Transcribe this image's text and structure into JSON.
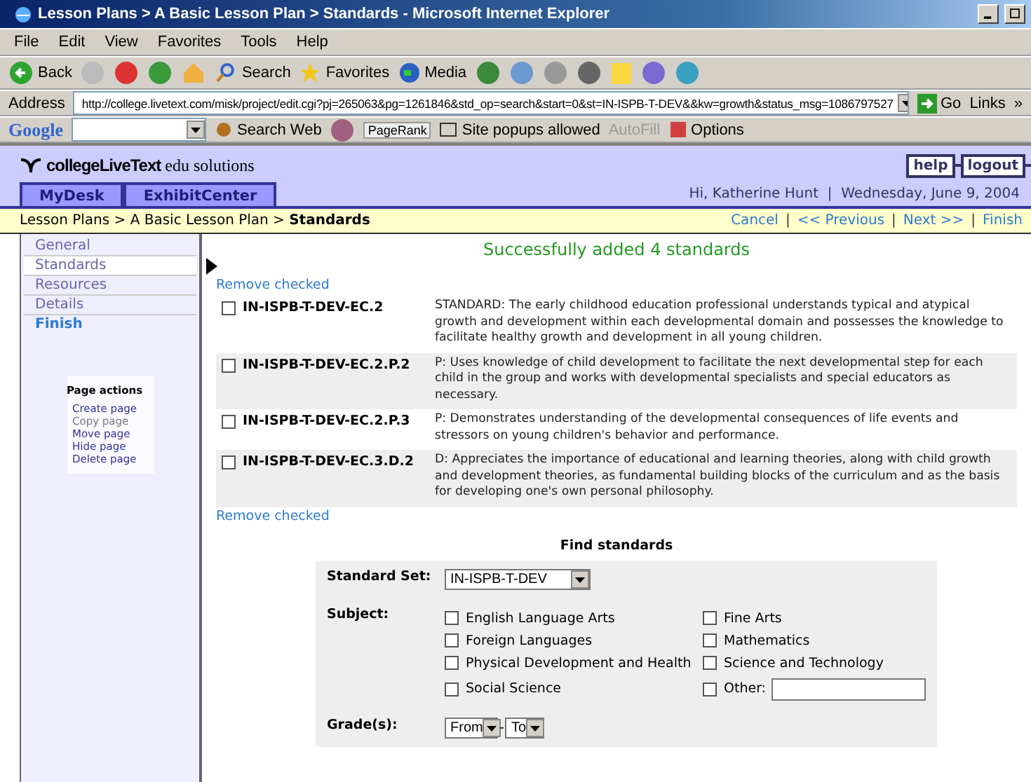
{
  "window": {
    "title": "Lesson Plans > A Basic Lesson Plan > Standards - Microsoft Internet Explorer"
  },
  "menu": [
    "File",
    "Edit",
    "View",
    "Favorites",
    "Tools",
    "Help"
  ],
  "toolbar": {
    "back": "Back",
    "search": "Search",
    "favorites": "Favorites",
    "media": "Media"
  },
  "address": {
    "label": "Address",
    "url": "http://college.livetext.com/misk/project/edit.cgi?pj=265063&pg=1261846&std_op=search&start=0&st=IN-ISPB-T-DEV&&kw=growth&status_msg=1086797527",
    "go": "Go",
    "links": "Links",
    "more": "»"
  },
  "google_bar": {
    "logo": "Google",
    "search_web": "Search Web",
    "pagerank": "PageRank",
    "popups": "Site popups allowed",
    "autofill": "AutoFill",
    "options": "Options"
  },
  "site": {
    "logo": "collegeLiveText",
    "logo_suffix": "edu solutions",
    "help": "help",
    "logout": "logout",
    "tabs": [
      {
        "label": "MyDesk"
      },
      {
        "label": "ExhibitCenter"
      }
    ],
    "greeting": "Hi, Katherine Hunt",
    "greeting_separator": "|",
    "date": "Wednesday, June 9, 2004"
  },
  "breadcrumb": {
    "parts": [
      "Lesson Plans",
      "A Basic Lesson Plan"
    ],
    "current": "Standards",
    "separator": ">"
  },
  "wizard_nav": [
    "Cancel",
    "<< Previous",
    "Next >>",
    "Finish"
  ],
  "wizard_nav_separator": "|",
  "sidebar": {
    "steps": [
      {
        "label": "General",
        "selected": false,
        "kind": "step"
      },
      {
        "label": "Standards",
        "selected": true,
        "kind": "step"
      },
      {
        "label": "Resources",
        "selected": false,
        "kind": "step"
      },
      {
        "label": "Details",
        "selected": false,
        "kind": "step"
      },
      {
        "label": "Finish",
        "selected": false,
        "kind": "finish"
      }
    ],
    "page_actions": {
      "title": "Page actions",
      "items": [
        {
          "label": "Create page",
          "disabled": false
        },
        {
          "label": "Copy page",
          "disabled": true
        },
        {
          "label": "Move page",
          "disabled": false
        },
        {
          "label": "Hide page",
          "disabled": false
        },
        {
          "label": "Delete page",
          "disabled": false
        }
      ]
    }
  },
  "status_message": "Successfully added 4 standards",
  "remove_checked": [
    "Remove checked",
    "Remove checked"
  ],
  "standards": [
    {
      "code": "IN-ISPB-T-DEV-EC.2",
      "description": "STANDARD: The early childhood education professional understands typical and atypical growth and development within each developmental domain and possesses the knowledge to facilitate healthy growth and development in all young children.",
      "checked": false
    },
    {
      "code": "IN-ISPB-T-DEV-EC.2.P.2",
      "description": "P: Uses knowledge of child development to facilitate the next developmental step for each child in the group and works with developmental specialists and special educators as necessary.",
      "checked": false
    },
    {
      "code": "IN-ISPB-T-DEV-EC.2.P.3",
      "description": "P: Demonstrates understanding of the developmental consequences of life events and stressors on young children's behavior and performance.",
      "checked": false
    },
    {
      "code": "IN-ISPB-T-DEV-EC.3.D.2",
      "description": "D: Appreciates the importance of educational and learning theories, along with child growth and development theories, as fundamental building blocks of the curriculum and as the basis for developing one's own personal philosophy.",
      "checked": false
    }
  ],
  "find_standards": {
    "title": "Find standards",
    "standard_set_label": "Standard Set:",
    "standard_set": "IN-ISPB-T-DEV",
    "subject_label": "Subject:",
    "subjects": [
      {
        "label": "English Language Arts",
        "checked": false
      },
      {
        "label": "Fine Arts",
        "checked": false
      },
      {
        "label": "Foreign Languages",
        "checked": false
      },
      {
        "label": "Mathematics",
        "checked": false
      },
      {
        "label": "Physical Development and Health",
        "checked": false
      },
      {
        "label": "Science and Technology",
        "checked": false
      },
      {
        "label": "Social Science",
        "checked": false
      },
      {
        "label": "Other:",
        "checked": false,
        "kind": "other"
      }
    ],
    "grades_label": "Grade(s):",
    "grade_from": "From",
    "grade_to": "To",
    "grade_separator": "-"
  }
}
